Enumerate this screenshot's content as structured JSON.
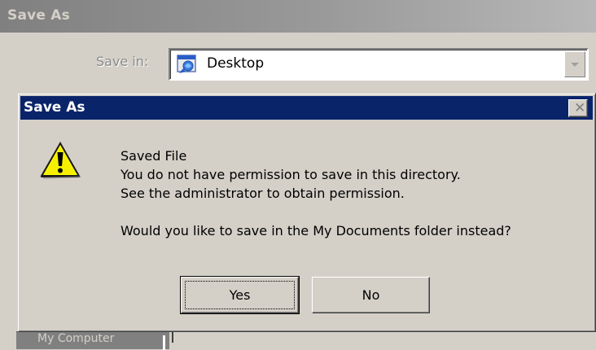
{
  "background_window": {
    "title": "Save As",
    "save_in_label": "Save in:",
    "save_in_value": "Desktop",
    "partial_item": "My Computer"
  },
  "dialog": {
    "title": "Save As",
    "close_glyph": "✕",
    "message": {
      "line1": "Saved File",
      "line2": "You do not have permission to save in this directory.",
      "line3": "See the administrator to obtain permission.",
      "line4": "Would you like to save in the My Documents folder instead?"
    },
    "buttons": {
      "yes": "Yes",
      "no": "No"
    },
    "icon": "warning-icon"
  },
  "colors": {
    "active_title": "#0a246a",
    "inactive_title": "#808080",
    "face": "#d4d0c8",
    "warning_yellow": "#ffff00"
  }
}
